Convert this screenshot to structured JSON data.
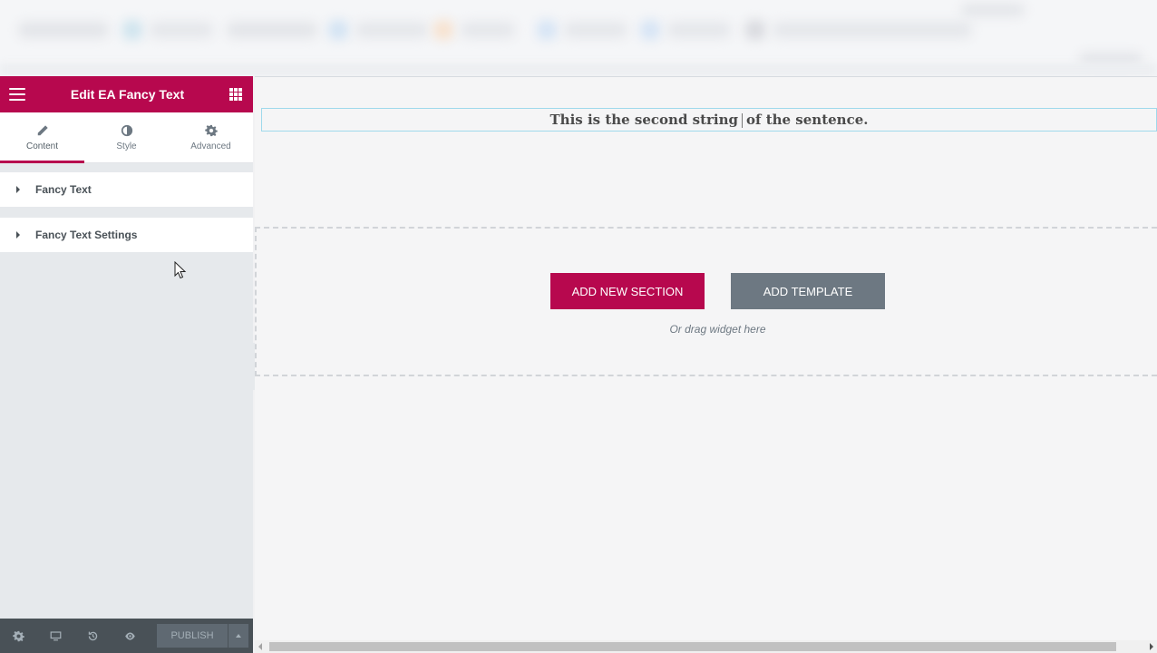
{
  "panel": {
    "title": "Edit EA Fancy Text",
    "tabs": [
      {
        "label": "Content",
        "icon": "pencil-icon",
        "active": true
      },
      {
        "label": "Style",
        "icon": "contrast-icon",
        "active": false
      },
      {
        "label": "Advanced",
        "icon": "gear-icon",
        "active": false
      }
    ],
    "sections": [
      {
        "label": "Fancy Text"
      },
      {
        "label": "Fancy Text Settings"
      }
    ],
    "footer": {
      "icons": [
        "settings-icon",
        "responsive-icon",
        "history-icon",
        "preview-icon"
      ],
      "publish_label": "PUBLISH"
    }
  },
  "preview": {
    "fancy_text_before": "This is the second string",
    "fancy_text_after": "of the sentence.",
    "add_section_label": "ADD NEW SECTION",
    "add_template_label": "ADD TEMPLATE",
    "drag_hint": "Or drag widget here"
  },
  "colors": {
    "brand": "#b7084e",
    "panel_bg": "#e6e9ec",
    "footer_bg": "#495157",
    "template_btn": "#6d7882"
  }
}
